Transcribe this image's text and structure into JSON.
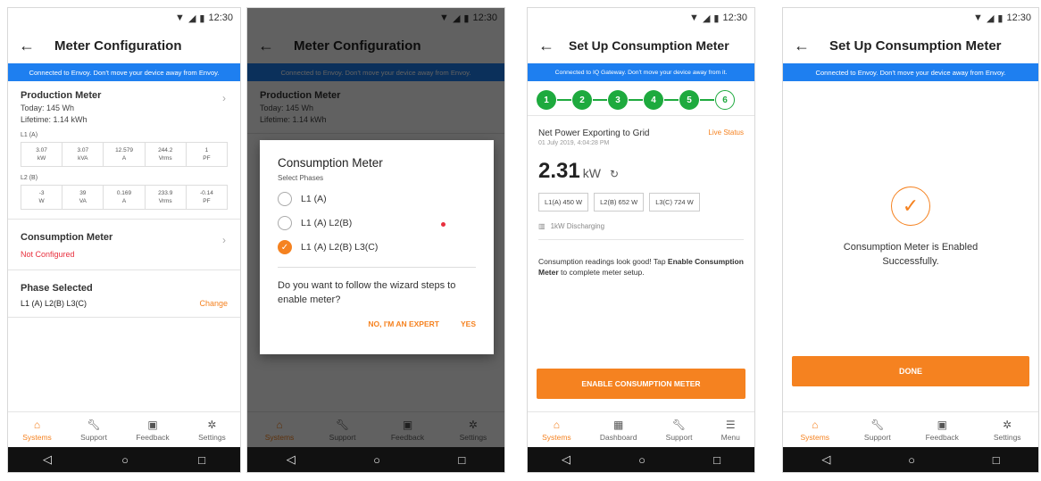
{
  "colors": {
    "accent": "#f58220",
    "banner": "#1e7ff0",
    "step": "#1eaa3e",
    "error": "#e8303e"
  },
  "status": {
    "time": "12:30"
  },
  "system_nav": {
    "back": "◁",
    "home": "○",
    "recent": "□"
  },
  "screen1": {
    "title": "Meter Configuration",
    "banner": "Connected to Envoy. Don't move your device away from Envoy.",
    "production": {
      "title": "Production Meter",
      "today": "Today: 145 Wh",
      "lifetime": "Lifetime: 1.14 kWh",
      "l1_label": "L1 (A)",
      "l1": [
        [
          "3.07",
          "kW"
        ],
        [
          "3.07",
          "kVA"
        ],
        [
          "12.579",
          "A"
        ],
        [
          "244.2",
          "Vrms"
        ],
        [
          "1",
          "PF"
        ]
      ],
      "l2_label": "L2 (B)",
      "l2": [
        [
          "-3",
          "W"
        ],
        [
          "39",
          "VA"
        ],
        [
          "0.169",
          "A"
        ],
        [
          "233.9",
          "Vrms"
        ],
        [
          "-0.14",
          "PF"
        ]
      ]
    },
    "consumption": {
      "title": "Consumption Meter",
      "status": "Not Configured"
    },
    "phase": {
      "title": "Phase Selected",
      "value": "L1 (A) L2(B) L3(C)",
      "change": "Change"
    },
    "nav": [
      "Systems",
      "Support",
      "Feedback",
      "Settings"
    ]
  },
  "screen2": {
    "dialog_title": "Consumption Meter",
    "dialog_sub": "Select Phases",
    "options": [
      "L1 (A)",
      "L1 (A) L2(B)",
      "L1 (A) L2(B) L3(C)"
    ],
    "selected_index": 2,
    "question": "Do you want to follow the wizard steps to enable meter?",
    "expert_button": "NO, I'M AN EXPERT",
    "yes_button": "YES"
  },
  "screen3": {
    "title": "Set Up Consumption Meter",
    "banner": "Connected to IQ Gateway. Don't move your device away from it.",
    "steps": [
      "1",
      "2",
      "3",
      "4",
      "5",
      "6"
    ],
    "net_title": "Net Power Exporting to Grid",
    "live_status": "Live Status",
    "timestamp": "01 July 2019, 4:04:28 PM",
    "value": "2.31",
    "unit": "kW",
    "phases": [
      "L1(A) 450 W",
      "L2(B) 652 W",
      "L3(C) 724 W"
    ],
    "battery": "1kW Discharging",
    "msg_pre": "Consumption readings look good! Tap ",
    "msg_bold": "Enable Consumption Meter",
    "msg_post": " to complete meter setup.",
    "enable_button": "ENABLE CONSUMPTION METER",
    "nav": [
      "Systems",
      "Dashboard",
      "Support",
      "Menu"
    ]
  },
  "screen4": {
    "title": "Set Up Consumption Meter",
    "banner": "Connected to Envoy. Don't move your device away from Envoy.",
    "success": "Consumption Meter is Enabled Successfully.",
    "done_button": "DONE",
    "nav": [
      "Systems",
      "Support",
      "Feedback",
      "Settings"
    ]
  }
}
